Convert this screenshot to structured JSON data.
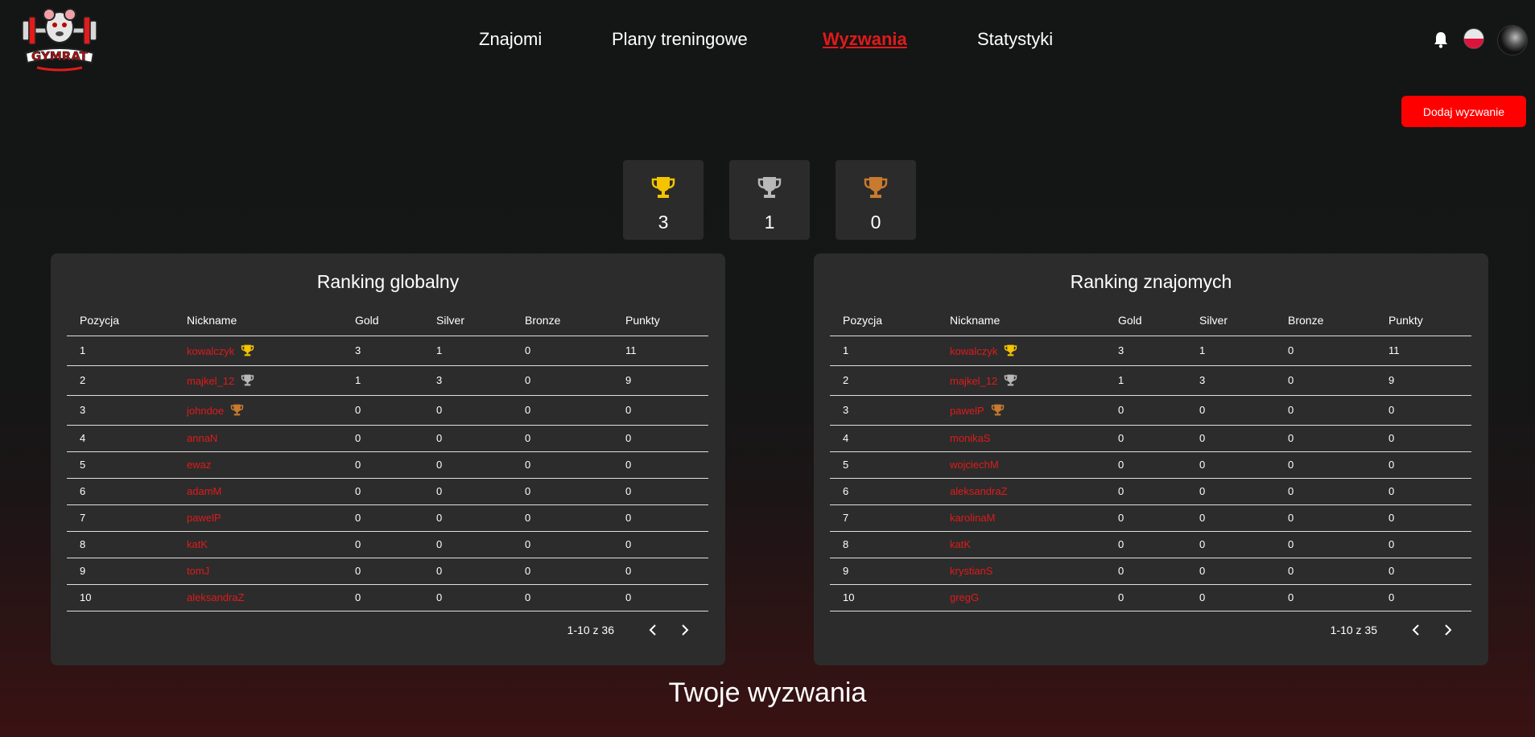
{
  "header": {
    "logo_text": "GYMRAT",
    "nav": [
      {
        "label": "Znajomi",
        "active": false
      },
      {
        "label": "Plany treningowe",
        "active": false
      },
      {
        "label": "Wyzwania",
        "active": true
      },
      {
        "label": "Statystyki",
        "active": false
      }
    ],
    "icons": [
      "bell-icon",
      "polish-flag-icon",
      "avatar"
    ]
  },
  "actions": {
    "add_challenge_label": "Dodaj wyzwanie"
  },
  "trophies": {
    "gold": 3,
    "silver": 1,
    "bronze": 0
  },
  "colors": {
    "accent": "#ff0000",
    "link": "#e01a1a",
    "gold": "#f5c400",
    "silver": "#b8b8b8",
    "bronze": "#c87a2e",
    "panel": "#2c2c2c"
  },
  "global_ranking": {
    "title": "Ranking globalny",
    "columns": [
      "Pozycja",
      "Nickname",
      "Gold",
      "Silver",
      "Bronze",
      "Punkty"
    ],
    "rows": [
      {
        "pos": "1",
        "nick": "kowalczyk",
        "trophy": "gold",
        "gold": "3",
        "silver": "1",
        "bronze": "0",
        "points": "11"
      },
      {
        "pos": "2",
        "nick": "majkel_12",
        "trophy": "silver",
        "gold": "1",
        "silver": "3",
        "bronze": "0",
        "points": "9"
      },
      {
        "pos": "3",
        "nick": "johndoe",
        "trophy": "bronze",
        "gold": "0",
        "silver": "0",
        "bronze": "0",
        "points": "0"
      },
      {
        "pos": "4",
        "nick": "annaN",
        "trophy": "",
        "gold": "0",
        "silver": "0",
        "bronze": "0",
        "points": "0"
      },
      {
        "pos": "5",
        "nick": "ewaz",
        "trophy": "",
        "gold": "0",
        "silver": "0",
        "bronze": "0",
        "points": "0"
      },
      {
        "pos": "6",
        "nick": "adamM",
        "trophy": "",
        "gold": "0",
        "silver": "0",
        "bronze": "0",
        "points": "0"
      },
      {
        "pos": "7",
        "nick": "pawelP",
        "trophy": "",
        "gold": "0",
        "silver": "0",
        "bronze": "0",
        "points": "0"
      },
      {
        "pos": "8",
        "nick": "katK",
        "trophy": "",
        "gold": "0",
        "silver": "0",
        "bronze": "0",
        "points": "0"
      },
      {
        "pos": "9",
        "nick": "tomJ",
        "trophy": "",
        "gold": "0",
        "silver": "0",
        "bronze": "0",
        "points": "0"
      },
      {
        "pos": "10",
        "nick": "aleksandraZ",
        "trophy": "",
        "gold": "0",
        "silver": "0",
        "bronze": "0",
        "points": "0"
      }
    ],
    "range_label": "1-10 z 36"
  },
  "friends_ranking": {
    "title": "Ranking znajomych",
    "columns": [
      "Pozycja",
      "Nickname",
      "Gold",
      "Silver",
      "Bronze",
      "Punkty"
    ],
    "rows": [
      {
        "pos": "1",
        "nick": "kowalczyk",
        "trophy": "gold",
        "gold": "3",
        "silver": "1",
        "bronze": "0",
        "points": "11"
      },
      {
        "pos": "2",
        "nick": "majkel_12",
        "trophy": "silver",
        "gold": "1",
        "silver": "3",
        "bronze": "0",
        "points": "9"
      },
      {
        "pos": "3",
        "nick": "pawelP",
        "trophy": "bronze",
        "gold": "0",
        "silver": "0",
        "bronze": "0",
        "points": "0"
      },
      {
        "pos": "4",
        "nick": "monikaS",
        "trophy": "",
        "gold": "0",
        "silver": "0",
        "bronze": "0",
        "points": "0"
      },
      {
        "pos": "5",
        "nick": "wojciechM",
        "trophy": "",
        "gold": "0",
        "silver": "0",
        "bronze": "0",
        "points": "0"
      },
      {
        "pos": "6",
        "nick": "aleksandraZ",
        "trophy": "",
        "gold": "0",
        "silver": "0",
        "bronze": "0",
        "points": "0"
      },
      {
        "pos": "7",
        "nick": "karolinaM",
        "trophy": "",
        "gold": "0",
        "silver": "0",
        "bronze": "0",
        "points": "0"
      },
      {
        "pos": "8",
        "nick": "katK",
        "trophy": "",
        "gold": "0",
        "silver": "0",
        "bronze": "0",
        "points": "0"
      },
      {
        "pos": "9",
        "nick": "krystianS",
        "trophy": "",
        "gold": "0",
        "silver": "0",
        "bronze": "0",
        "points": "0"
      },
      {
        "pos": "10",
        "nick": "gregG",
        "trophy": "",
        "gold": "0",
        "silver": "0",
        "bronze": "0",
        "points": "0"
      }
    ],
    "range_label": "1-10 z 35"
  },
  "challenges_section": {
    "title": "Twoje wyzwania"
  }
}
